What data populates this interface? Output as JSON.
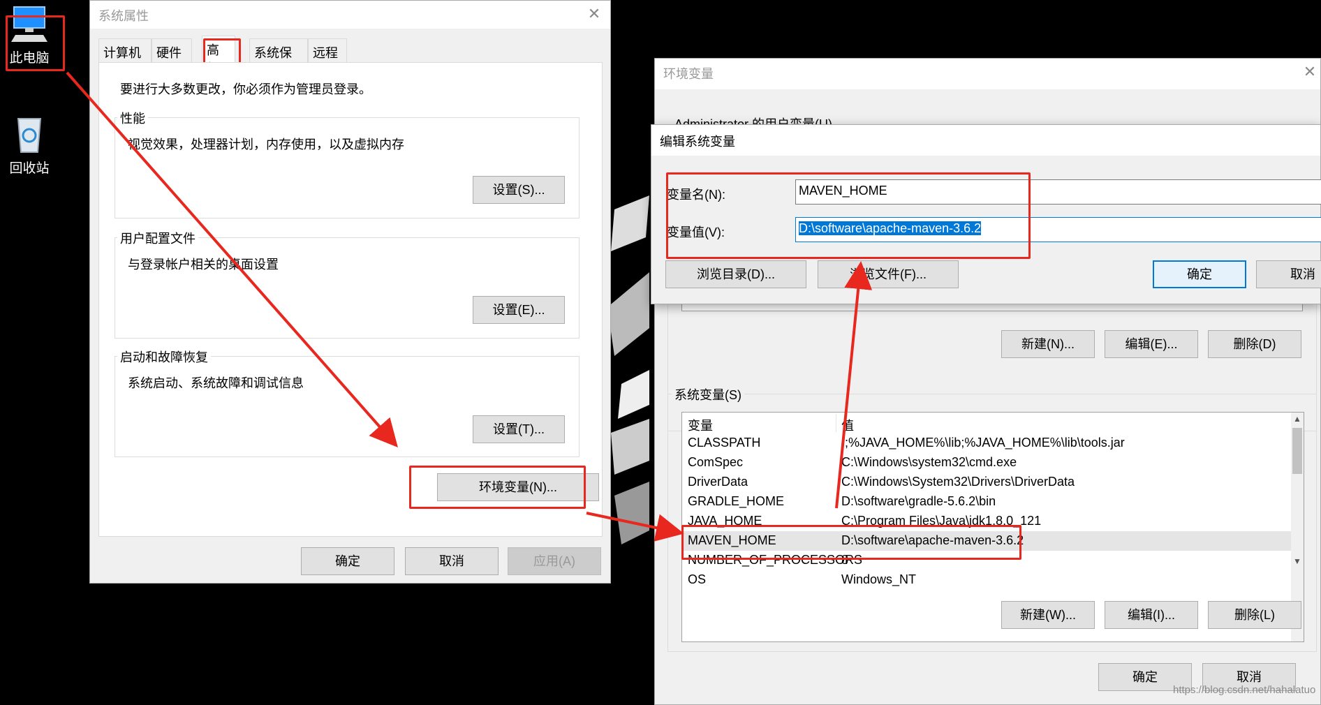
{
  "desktop": {
    "this_pc_label": "此电脑",
    "recycle_bin_label": "回收站"
  },
  "sysprops": {
    "title": "系统属性",
    "tabs": [
      "计算机名",
      "硬件",
      "高级",
      "系统保护",
      "远程"
    ],
    "admin_note": "要进行大多数更改，你必须作为管理员登录。",
    "performance": {
      "title": "性能",
      "desc": "视觉效果，处理器计划，内存使用，以及虚拟内存",
      "button": "设置(S)..."
    },
    "profiles": {
      "title": "用户配置文件",
      "desc": "与登录帐户相关的桌面设置",
      "button": "设置(E)..."
    },
    "startup": {
      "title": "启动和故障恢复",
      "desc": "系统启动、系统故障和调试信息",
      "button": "设置(T)..."
    },
    "env_button": "环境变量(N)...",
    "ok": "确定",
    "cancel": "取消",
    "apply": "应用(A)"
  },
  "envvars": {
    "title": "环境变量",
    "user_section": "Administrator 的用户变量(U)",
    "user_buttons": {
      "new": "新建(N)...",
      "edit": "编辑(E)...",
      "delete": "删除(D)"
    },
    "system_section": "系统变量(S)",
    "columns": {
      "var": "变量",
      "val": "值"
    },
    "rows": [
      {
        "name": "CLASSPATH",
        "value": ".;%JAVA_HOME%\\lib;%JAVA_HOME%\\lib\\tools.jar"
      },
      {
        "name": "ComSpec",
        "value": "C:\\Windows\\system32\\cmd.exe"
      },
      {
        "name": "DriverData",
        "value": "C:\\Windows\\System32\\Drivers\\DriverData"
      },
      {
        "name": "GRADLE_HOME",
        "value": "D:\\software\\gradle-5.6.2\\bin"
      },
      {
        "name": "JAVA_HOME",
        "value": "C:\\Program Files\\Java\\jdk1.8.0_121"
      },
      {
        "name": "MAVEN_HOME",
        "value": "D:\\software\\apache-maven-3.6.2"
      },
      {
        "name": "NUMBER_OF_PROCESSORS",
        "value": "8"
      },
      {
        "name": "OS",
        "value": "Windows_NT"
      }
    ],
    "system_buttons": {
      "new": "新建(W)...",
      "edit": "编辑(I)...",
      "delete": "删除(L)"
    },
    "ok": "确定",
    "cancel": "取消"
  },
  "editvar": {
    "title": "编辑系统变量",
    "name_label": "变量名(N):",
    "name_value": "MAVEN_HOME",
    "value_label": "变量值(V):",
    "value_value": "D:\\software\\apache-maven-3.6.2",
    "browse_dir": "浏览目录(D)...",
    "browse_file": "浏览文件(F)...",
    "ok": "确定",
    "cancel": "取消"
  },
  "watermark": "https://blog.csdn.net/hahalatuo",
  "colors": {
    "annotation_red": "#e8271f",
    "accent_blue": "#0078d7"
  }
}
